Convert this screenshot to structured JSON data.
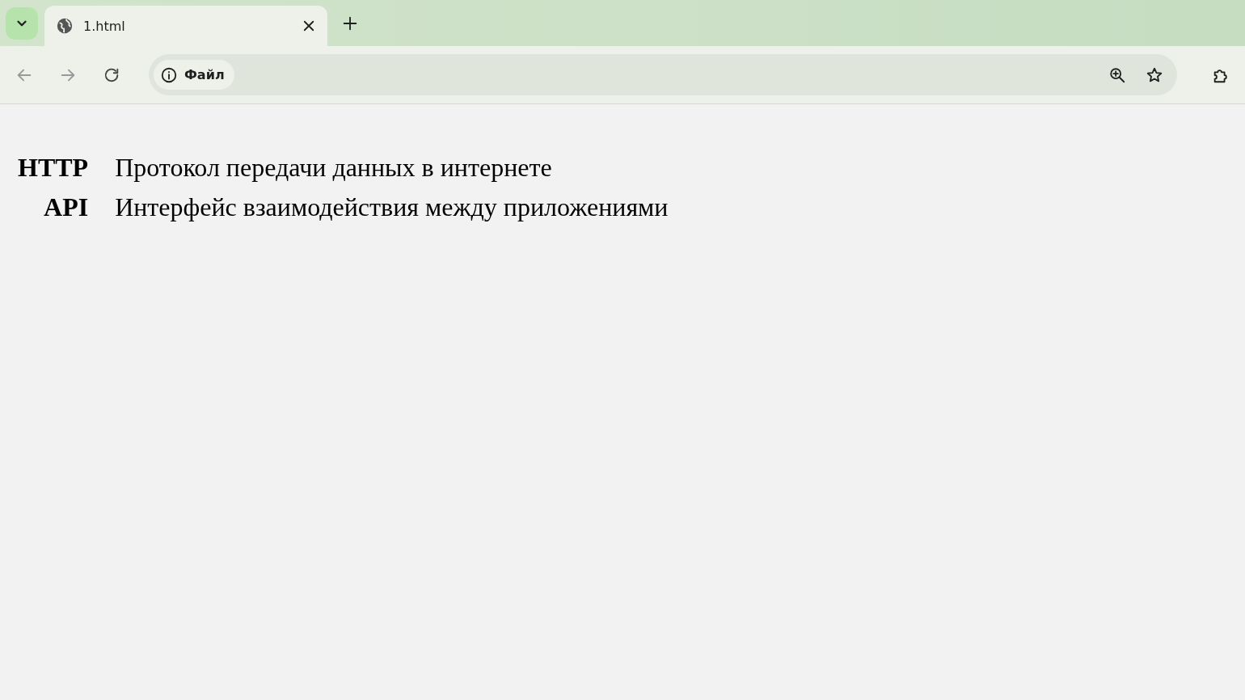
{
  "tabs": [
    {
      "title": "1.html",
      "selected": true
    }
  ],
  "address_bar": {
    "security_chip": "Файл"
  },
  "definitions": [
    {
      "term": "HTTP",
      "description": "Протокол передачи данных в интернете"
    },
    {
      "term": "API",
      "description": "Интерфейс взаимодействия между приложениями"
    }
  ]
}
